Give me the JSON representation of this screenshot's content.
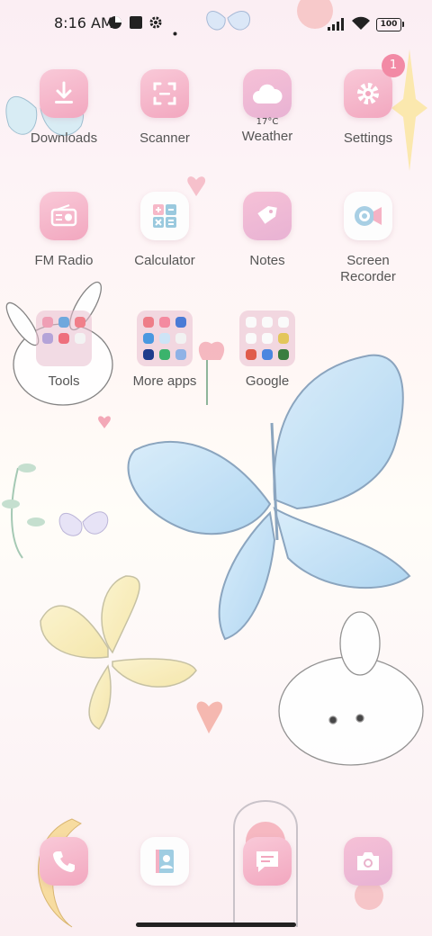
{
  "status_bar": {
    "time": "8:16 AM",
    "battery": "100",
    "icons": [
      "data-saver-icon",
      "stop-icon",
      "gear-icon",
      "dot-icon",
      "signal-icon",
      "wifi-icon",
      "battery-icon"
    ]
  },
  "apps": {
    "downloads": "Downloads",
    "scanner": "Scanner",
    "weather": "Weather",
    "weather_temp": "17°C",
    "settings": "Settings",
    "settings_badge": "1",
    "fm_radio": "FM Radio",
    "calculator": "Calculator",
    "notes": "Notes",
    "screen_recorder_line1": "Screen",
    "screen_recorder_line2": "Recorder"
  },
  "folders": {
    "tools": "Tools",
    "more_apps": "More apps",
    "google": "Google"
  },
  "dock": [
    "phone-icon",
    "contacts-icon",
    "messages-icon",
    "camera-icon"
  ],
  "colors": {
    "accent_pink": "#f2a7bf",
    "badge": "#f28aa5"
  }
}
